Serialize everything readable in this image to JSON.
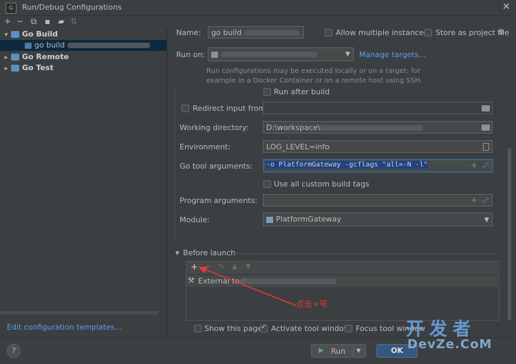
{
  "window": {
    "title": "Run/Debug Configurations",
    "close": "✕"
  },
  "left": {
    "tree": [
      {
        "label": "Go Build"
      },
      {
        "label": "go build"
      },
      {
        "label": "Go Remote"
      },
      {
        "label": "Go Test"
      }
    ],
    "edit_templates": "Edit configuration templates..."
  },
  "form": {
    "name_label": "Name:",
    "name_value": "go build",
    "allow_multiple": "Allow multiple instances",
    "store_as_project": "Store as project file",
    "run_on_label": "Run on:",
    "manage_targets": "Manage targets...",
    "run_on_hint_1": "Run configurations may be executed locally or on a target: for",
    "run_on_hint_2": "example in a Docker Container or on a remote host using SSH.",
    "run_after_build": "Run after build",
    "redirect_input": "Redirect input from:",
    "working_dir_label": "Working directory:",
    "working_dir_value": "D:\\workspace\\",
    "environment_label": "Environment:",
    "environment_value": "LOG_LEVEL=info",
    "go_tool_args_label": "Go tool arguments:",
    "go_tool_args_value": "-o PlatformGateway -gcflags \"all=-N -l\"",
    "use_custom_tags": "Use all custom build tags",
    "program_args_label": "Program arguments:",
    "module_label": "Module:",
    "module_value": "PlatformGateway"
  },
  "before_launch": {
    "title": "Before launch",
    "item": "External tool"
  },
  "options": {
    "show_page": "Show this page",
    "activate_tool_window": "Activate tool window",
    "focus_tool_window": "Focus tool window"
  },
  "buttons": {
    "help": "?",
    "run": "Run",
    "ok": "OK"
  },
  "annotation": {
    "text": "点击+号",
    "color": "#e53935"
  },
  "watermark": {
    "line1": "开发者",
    "line2": "DevZe.CoM"
  },
  "colors": {
    "accent": "#589df6",
    "selection": "#0d293e",
    "focus": "#3d6185"
  }
}
